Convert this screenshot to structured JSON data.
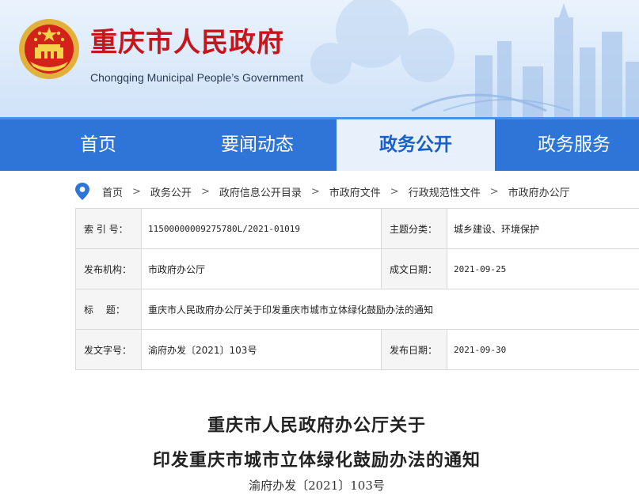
{
  "header": {
    "title": "重庆市人民政府",
    "subtitle": "Chongqing Municipal People’s Government"
  },
  "nav": {
    "items": [
      {
        "label": "首页",
        "active": false
      },
      {
        "label": "要闻动态",
        "active": false
      },
      {
        "label": "政务公开",
        "active": true
      },
      {
        "label": "政务服务",
        "active": false
      }
    ]
  },
  "breadcrumb": {
    "items": [
      "首页",
      "政务公开",
      "政府信息公开目录",
      "市政府文件",
      "行政规范性文件",
      "市政府办公厅"
    ],
    "separator": ">"
  },
  "meta": {
    "index_label": "索 引 号：",
    "index_value": "11500000009275780L/2021-01019",
    "topic_label": "主题分类：",
    "topic_value": "城乡建设、环境保护",
    "issuer_label": "发布机构：",
    "issuer_value": "市政府办公厅",
    "written_label": "成文日期：",
    "written_value": "2021-09-25",
    "title_label": "标　 题：",
    "title_value": "重庆市人民政府办公厅关于印发重庆市城市立体绿化鼓励办法的通知",
    "docno_label": "发文字号：",
    "docno_value": "渝府办发〔2021〕103号",
    "pubdate_label": "发布日期：",
    "pubdate_value": "2021-09-30"
  },
  "article": {
    "title_line1": "重庆市人民政府办公厅关于",
    "title_line2": "印发重庆市城市立体绿化鼓励办法的通知",
    "doc_number": "渝府办发〔2021〕103号"
  },
  "colors": {
    "brand_red": "#c6161c",
    "nav_blue": "#2f75d8",
    "nav_active_bg": "#e8f0fb"
  },
  "icons": {
    "location": "location-pin-icon",
    "emblem": "national-emblem-icon"
  }
}
